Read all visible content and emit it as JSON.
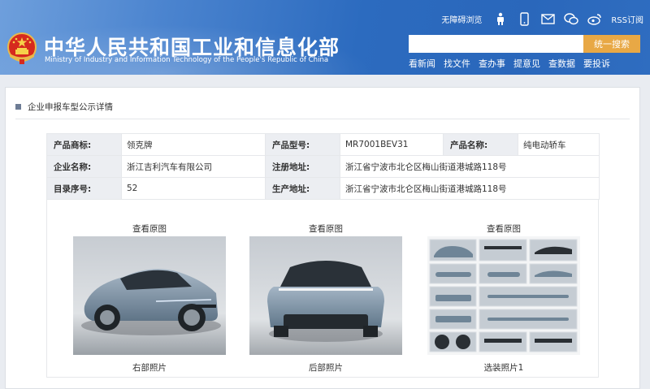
{
  "header": {
    "title_cn": "中华人民共和国工业和信息化部",
    "title_en": "Ministry of Industry and Information Technology of the People's Republic of China",
    "accessibility": "无障碍浏览",
    "rss": "RSS订阅",
    "search_button": "统一搜索",
    "search_placeholder": "",
    "nav": [
      "看新闻",
      "找文件",
      "查办事",
      "提意见",
      "查数据",
      "要投诉"
    ]
  },
  "section": {
    "title": "企业申报车型公示详情"
  },
  "vehicle": {
    "rows": [
      [
        {
          "label": "产品商标:",
          "value": "领克牌"
        },
        {
          "label": "产品型号:",
          "value": "MR7001BEV31"
        },
        {
          "label": "产品名称:",
          "value": "纯电动轿车"
        }
      ],
      [
        {
          "label": "企业名称:",
          "value": "浙江吉利汽车有限公司"
        },
        {
          "label": "注册地址:",
          "value": "浙江省宁波市北仑区梅山街道港城路118号"
        }
      ],
      [
        {
          "label": "目录序号:",
          "value": "52"
        },
        {
          "label": "生产地址:",
          "value": "浙江省宁波市北仑区梅山街道港城路118号"
        }
      ]
    ]
  },
  "photos": [
    {
      "view_label": "查看原图",
      "caption": "右部照片"
    },
    {
      "view_label": "查看原图",
      "caption": "后部照片"
    },
    {
      "view_label": "查看原图",
      "caption": "选装照片1"
    }
  ],
  "colors": {
    "header_blue": "#2c6bbf",
    "search_orange": "#e8a845",
    "label_bg": "#eceef2",
    "car_body": "#7e93a6"
  },
  "icons": [
    "emblem",
    "accessibility-icon",
    "mobile-icon",
    "mail-icon",
    "wechat-icon",
    "weibo-icon"
  ]
}
